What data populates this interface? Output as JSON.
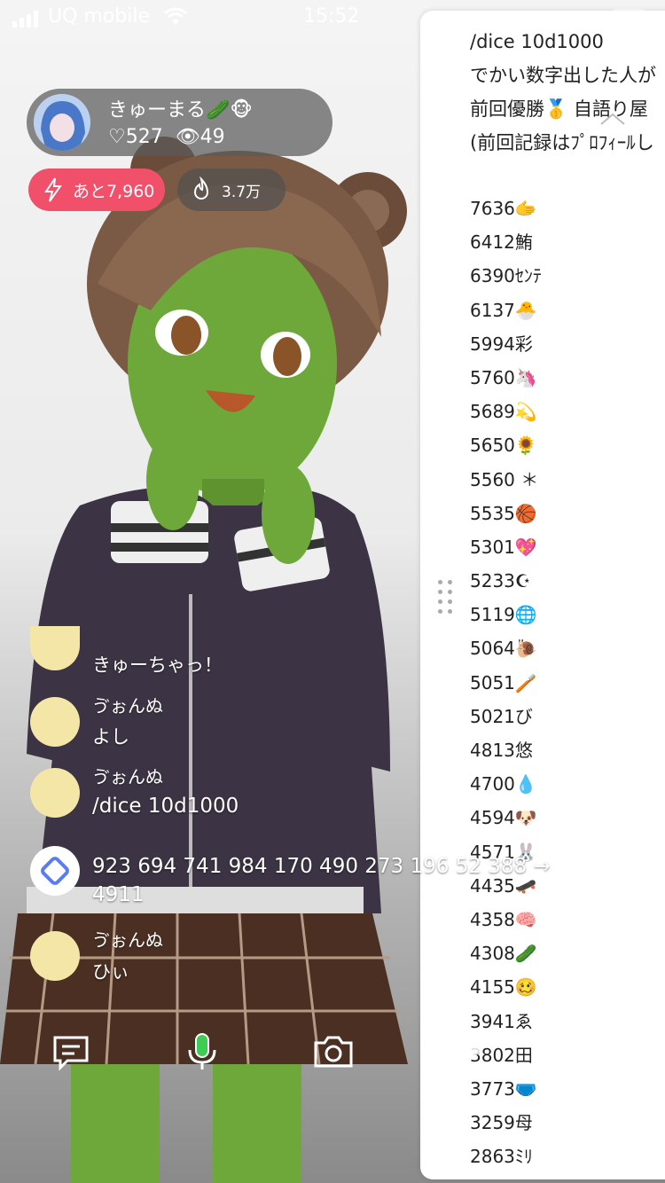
{
  "status": {
    "carrier": "UQ mobile",
    "time": "15:52"
  },
  "host": {
    "name": "きゅーまる🥒🐵",
    "likes": "♡527",
    "viewers": "👁49"
  },
  "pills": {
    "remaining": "あと7,960",
    "fire": "3.7万"
  },
  "panel": {
    "header": [
      "/dice 10d1000",
      "でかい数字出した人が",
      "前回優勝🥇 自語り屋",
      "(前回記録はﾌﾟﾛﾌｨｰﾙし"
    ],
    "scores": [
      "7636🫱",
      "6412鮪",
      "6390ｾﾝﾃ",
      "6137🐣",
      "5994彩",
      "5760🦄",
      "5689💫",
      "5650🌻",
      "5560 ＊",
      "5535🏀",
      "5301💖",
      "5233☪",
      "5119🌐",
      "5064🐌",
      "5051🪥",
      "5021び",
      "4813悠",
      "4700💧",
      "4594🐶",
      "4571🐰",
      "4435🛹",
      "4358🧠",
      "4308🥒",
      "4155🥴",
      "3941ゑ",
      "3802田",
      "3773🩲",
      "3259母",
      "2863ﾐﾘ"
    ]
  },
  "chat": [
    {
      "name": "",
      "text": "きゅーちゃっ！"
    },
    {
      "name": "ゔぉんぬ",
      "text": "よし"
    },
    {
      "name": "ゔぉんぬ",
      "text": "/dice 10d1000"
    },
    {
      "name": "",
      "text": "923 694 741 984 170 490 273 196 52 388 →",
      "text2": "4911"
    },
    {
      "name": "ゔぉんぬ",
      "text": "ひぃ"
    }
  ],
  "colors": {
    "accent_red": "#f0506a",
    "mic_green": "#3fcc55"
  }
}
